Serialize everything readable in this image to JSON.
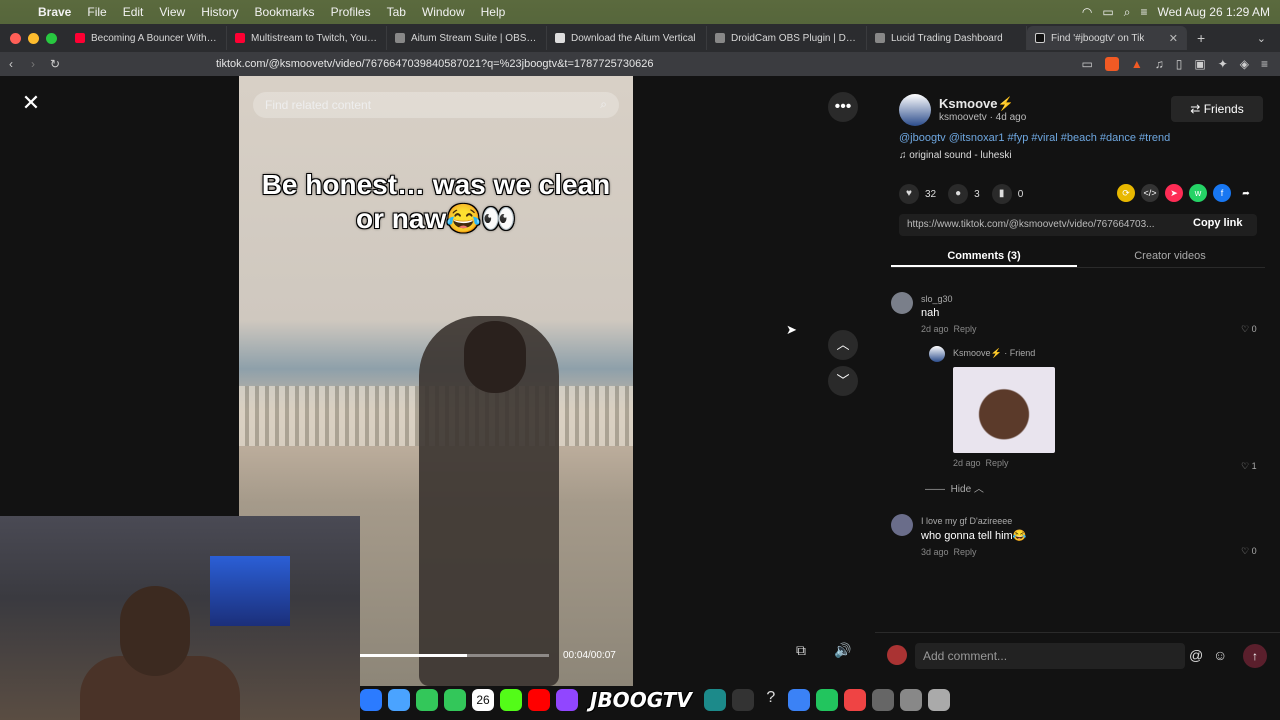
{
  "menubar": {
    "app": "Brave",
    "items": [
      "File",
      "Edit",
      "View",
      "History",
      "Bookmarks",
      "Profiles",
      "Tab",
      "Window",
      "Help"
    ],
    "clock": "Wed Aug 26  1:29 AM"
  },
  "tabs": [
    {
      "label": "Becoming A Bouncer With Ka",
      "fav": "#ff0033"
    },
    {
      "label": "Multistream to Twitch, YouTub",
      "fav": "#ff0033"
    },
    {
      "label": "Aitum Stream Suite | OBS For",
      "fav": "#888888"
    },
    {
      "label": "Download the Aitum Vertical",
      "fav": "#dddddd"
    },
    {
      "label": "DroidCam OBS Plugin | Dev4",
      "fav": "#888888"
    },
    {
      "label": "Lucid Trading Dashboard",
      "fav": "#888888"
    },
    {
      "label": "Find '#jboogtv' on Tik",
      "fav": "#111111"
    }
  ],
  "toolbar": {
    "url": "tiktok.com/@ksmoovetv/video/7676647039840587021?q=%23jboogtv&t=1787725730626"
  },
  "video": {
    "search_placeholder": "Find related content",
    "caption": "Be honest… was we clean or naw😂👀",
    "time": "00:04/00:07",
    "progress": 0.57
  },
  "author": {
    "name": "Ksmoove⚡",
    "handle": "ksmoovetv · 4d ago",
    "follow_label": "Friends",
    "hashtags": "@jboogtv @itsnoxar1 #fyp #viral #beach #dance #trend",
    "sound": "original sound - luheski"
  },
  "stats": {
    "likes": "32",
    "comments": "3",
    "saves": "0"
  },
  "link": {
    "url": "https://www.tiktok.com/@ksmoovetv/video/767664703...",
    "copy_label": "Copy link"
  },
  "panel_tabs": {
    "comments": "Comments (3)",
    "creator": "Creator videos"
  },
  "comments": [
    {
      "user": "slo_g30",
      "text": "nah",
      "age": "2d ago",
      "reply": "Reply",
      "likes": "0"
    },
    {
      "user": "Ksmoove⚡ · Friend",
      "text": "",
      "age": "2d ago",
      "reply": "Reply",
      "likes": "1"
    },
    {
      "user": "I love my gf D'azireeee",
      "text": "who gonna tell him😂",
      "age": "3d ago",
      "reply": "Reply",
      "likes": "0"
    }
  ],
  "hide_label": "Hide",
  "input": {
    "placeholder": "Add comment..."
  },
  "dock": {
    "calendar_day": "26",
    "brand": "JBOOGTV"
  }
}
